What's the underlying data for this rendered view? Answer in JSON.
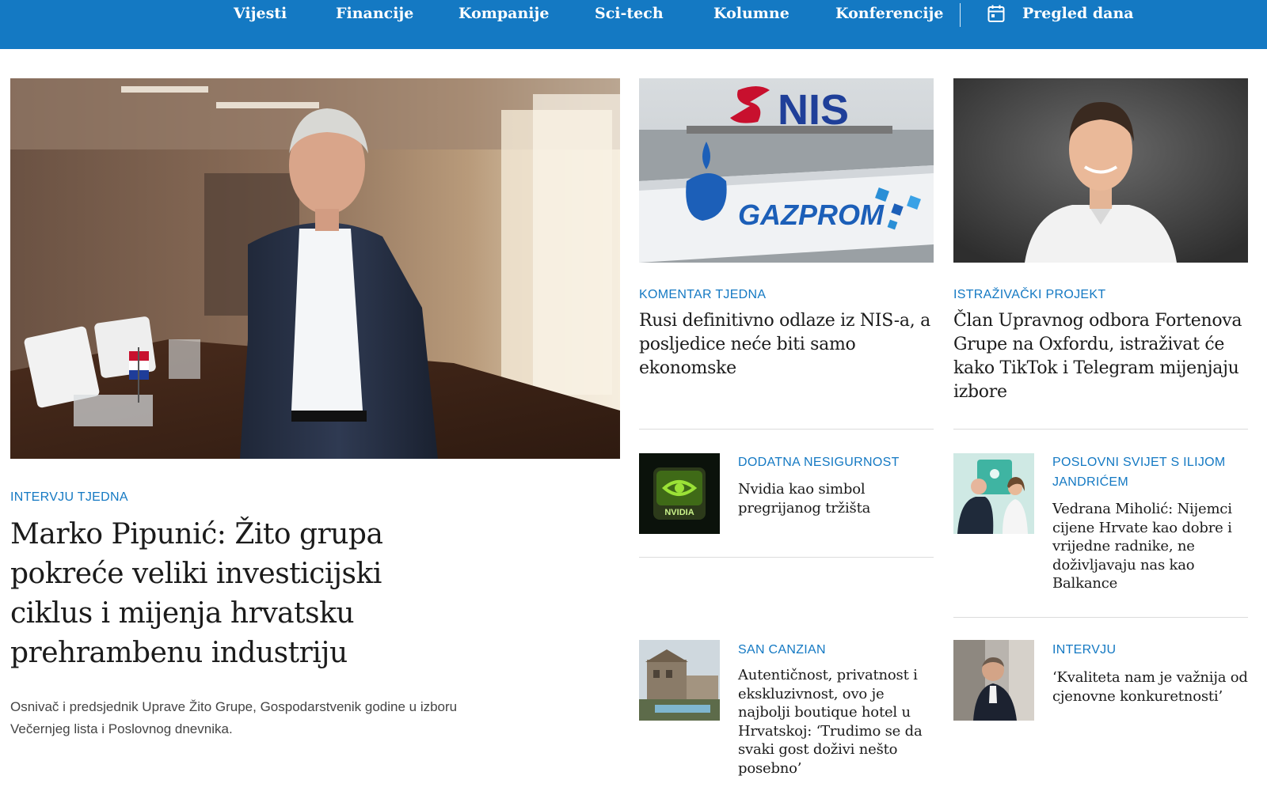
{
  "nav": {
    "items": [
      "Vijesti",
      "Financije",
      "Kompanije",
      "Sci-tech",
      "Kolumne",
      "Konferencije"
    ],
    "pregled_label": "Pregled dana",
    "pregled_icon": "calendar-icon"
  },
  "lead": {
    "kicker": "INTERVJU TJEDNA",
    "headline": "Marko Pipunić: Žito grupa pokreće veliki investicijski ciklus i mijenja hrvatsku prehrambenu industriju",
    "summary": "Osnivač i predsjednik Uprave Žito Grupe, Gospodarstvenik godine u izboru Večernjeg lista i Poslovnog dnevnika."
  },
  "top_cards": [
    {
      "kicker": "KOMENTAR TJEDNA",
      "headline": "Rusi definitivno odlaze iz NIS-a, a posljedice neće biti samo ekonomske",
      "image_text": [
        "NIS",
        "GAZPROM"
      ]
    },
    {
      "kicker": "ISTRAŽIVAČKI PROJEKT",
      "headline": "Član Upravnog odbora Fortenova Grupe na Oxfordu, istraživat će kako TikTok i Telegram mijenjaju izbore"
    }
  ],
  "small_cards": [
    {
      "kicker": "DODATNA NESIGURNOST",
      "headline": "Nvidia kao simbol pregrijanog tržišta",
      "image_text": "NVIDIA"
    },
    {
      "kicker": "POSLOVNI SVIJET S ILIJOM JANDRIĆEM",
      "headline": "Vedrana Miholić: Nijemci cijene Hrvate kao dobre i vrijedne radnike, ne doživljavaju nas kao Balkance"
    },
    {
      "kicker": "SAN CANZIAN",
      "headline": "Autentičnost, privatnost i ekskluzivnost, ovo je najbolji boutique hotel u Hrvatskoj: ‘Trudimo se da svaki gost doživi nešto posebno’"
    },
    {
      "kicker": "INTERVJU",
      "headline": "‘Kvaliteta nam je važnija od cjenovne konkuretnosti’"
    }
  ],
  "colors": {
    "nav_bg": "#1479c3",
    "accent": "#1479c3"
  }
}
